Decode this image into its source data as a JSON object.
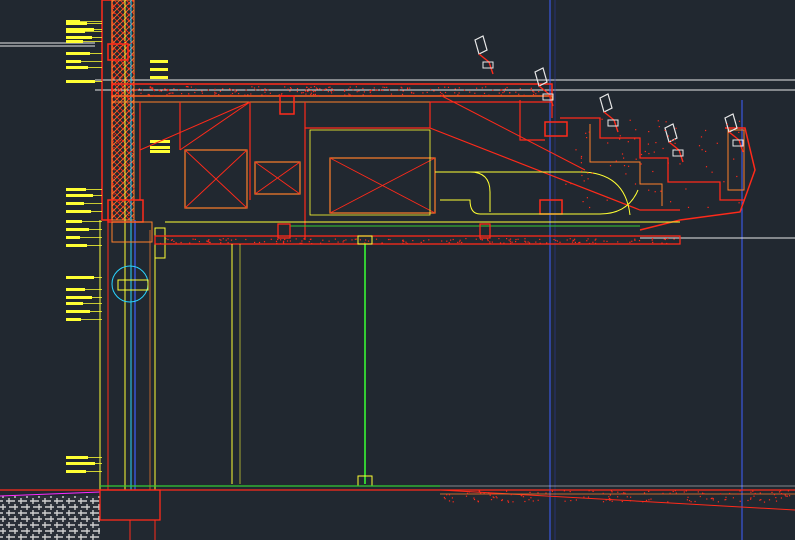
{
  "app": {
    "view": "cad-section-drawing"
  },
  "colors": {
    "background": "#212830",
    "red": "#ff2a1a",
    "orange": "#ff7f2a",
    "yellow": "#ffff33",
    "green": "#33cc33",
    "cyan": "#2ad4ff",
    "blue": "#3f5fff",
    "white": "#e8e8e8",
    "magenta": "#ff2aff",
    "hatch": "#cfcfcf"
  },
  "icons": {
    "annotation": "leader-callout-icon",
    "hatch": "insulation-hatch-icon",
    "seat": "theater-seat-icon",
    "duct": "hvac-duct-icon"
  }
}
